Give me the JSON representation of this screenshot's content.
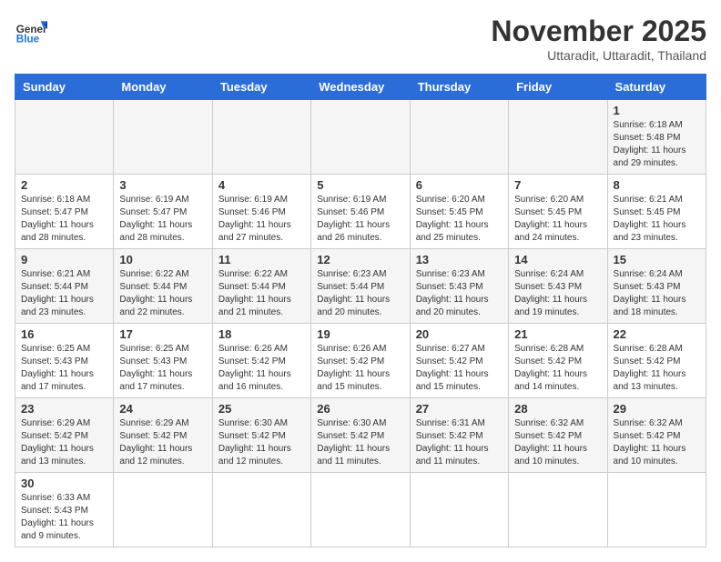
{
  "header": {
    "logo_general": "General",
    "logo_blue": "Blue",
    "month_title": "November 2025",
    "subtitle": "Uttaradit, Uttaradit, Thailand"
  },
  "days_of_week": [
    "Sunday",
    "Monday",
    "Tuesday",
    "Wednesday",
    "Thursday",
    "Friday",
    "Saturday"
  ],
  "weeks": [
    [
      {
        "day": "",
        "content": ""
      },
      {
        "day": "",
        "content": ""
      },
      {
        "day": "",
        "content": ""
      },
      {
        "day": "",
        "content": ""
      },
      {
        "day": "",
        "content": ""
      },
      {
        "day": "",
        "content": ""
      },
      {
        "day": "1",
        "content": "Sunrise: 6:18 AM\nSunset: 5:48 PM\nDaylight: 11 hours and 29 minutes."
      }
    ],
    [
      {
        "day": "2",
        "content": "Sunrise: 6:18 AM\nSunset: 5:47 PM\nDaylight: 11 hours and 28 minutes."
      },
      {
        "day": "3",
        "content": "Sunrise: 6:19 AM\nSunset: 5:47 PM\nDaylight: 11 hours and 28 minutes."
      },
      {
        "day": "4",
        "content": "Sunrise: 6:19 AM\nSunset: 5:46 PM\nDaylight: 11 hours and 27 minutes."
      },
      {
        "day": "5",
        "content": "Sunrise: 6:19 AM\nSunset: 5:46 PM\nDaylight: 11 hours and 26 minutes."
      },
      {
        "day": "6",
        "content": "Sunrise: 6:20 AM\nSunset: 5:45 PM\nDaylight: 11 hours and 25 minutes."
      },
      {
        "day": "7",
        "content": "Sunrise: 6:20 AM\nSunset: 5:45 PM\nDaylight: 11 hours and 24 minutes."
      },
      {
        "day": "8",
        "content": "Sunrise: 6:21 AM\nSunset: 5:45 PM\nDaylight: 11 hours and 23 minutes."
      }
    ],
    [
      {
        "day": "9",
        "content": "Sunrise: 6:21 AM\nSunset: 5:44 PM\nDaylight: 11 hours and 23 minutes."
      },
      {
        "day": "10",
        "content": "Sunrise: 6:22 AM\nSunset: 5:44 PM\nDaylight: 11 hours and 22 minutes."
      },
      {
        "day": "11",
        "content": "Sunrise: 6:22 AM\nSunset: 5:44 PM\nDaylight: 11 hours and 21 minutes."
      },
      {
        "day": "12",
        "content": "Sunrise: 6:23 AM\nSunset: 5:44 PM\nDaylight: 11 hours and 20 minutes."
      },
      {
        "day": "13",
        "content": "Sunrise: 6:23 AM\nSunset: 5:43 PM\nDaylight: 11 hours and 20 minutes."
      },
      {
        "day": "14",
        "content": "Sunrise: 6:24 AM\nSunset: 5:43 PM\nDaylight: 11 hours and 19 minutes."
      },
      {
        "day": "15",
        "content": "Sunrise: 6:24 AM\nSunset: 5:43 PM\nDaylight: 11 hours and 18 minutes."
      }
    ],
    [
      {
        "day": "16",
        "content": "Sunrise: 6:25 AM\nSunset: 5:43 PM\nDaylight: 11 hours and 17 minutes."
      },
      {
        "day": "17",
        "content": "Sunrise: 6:25 AM\nSunset: 5:43 PM\nDaylight: 11 hours and 17 minutes."
      },
      {
        "day": "18",
        "content": "Sunrise: 6:26 AM\nSunset: 5:42 PM\nDaylight: 11 hours and 16 minutes."
      },
      {
        "day": "19",
        "content": "Sunrise: 6:26 AM\nSunset: 5:42 PM\nDaylight: 11 hours and 15 minutes."
      },
      {
        "day": "20",
        "content": "Sunrise: 6:27 AM\nSunset: 5:42 PM\nDaylight: 11 hours and 15 minutes."
      },
      {
        "day": "21",
        "content": "Sunrise: 6:28 AM\nSunset: 5:42 PM\nDaylight: 11 hours and 14 minutes."
      },
      {
        "day": "22",
        "content": "Sunrise: 6:28 AM\nSunset: 5:42 PM\nDaylight: 11 hours and 13 minutes."
      }
    ],
    [
      {
        "day": "23",
        "content": "Sunrise: 6:29 AM\nSunset: 5:42 PM\nDaylight: 11 hours and 13 minutes."
      },
      {
        "day": "24",
        "content": "Sunrise: 6:29 AM\nSunset: 5:42 PM\nDaylight: 11 hours and 12 minutes."
      },
      {
        "day": "25",
        "content": "Sunrise: 6:30 AM\nSunset: 5:42 PM\nDaylight: 11 hours and 12 minutes."
      },
      {
        "day": "26",
        "content": "Sunrise: 6:30 AM\nSunset: 5:42 PM\nDaylight: 11 hours and 11 minutes."
      },
      {
        "day": "27",
        "content": "Sunrise: 6:31 AM\nSunset: 5:42 PM\nDaylight: 11 hours and 11 minutes."
      },
      {
        "day": "28",
        "content": "Sunrise: 6:32 AM\nSunset: 5:42 PM\nDaylight: 11 hours and 10 minutes."
      },
      {
        "day": "29",
        "content": "Sunrise: 6:32 AM\nSunset: 5:42 PM\nDaylight: 11 hours and 10 minutes."
      }
    ],
    [
      {
        "day": "30",
        "content": "Sunrise: 6:33 AM\nSunset: 5:43 PM\nDaylight: 11 hours and 9 minutes."
      },
      {
        "day": "",
        "content": ""
      },
      {
        "day": "",
        "content": ""
      },
      {
        "day": "",
        "content": ""
      },
      {
        "day": "",
        "content": ""
      },
      {
        "day": "",
        "content": ""
      },
      {
        "day": "",
        "content": ""
      }
    ]
  ]
}
